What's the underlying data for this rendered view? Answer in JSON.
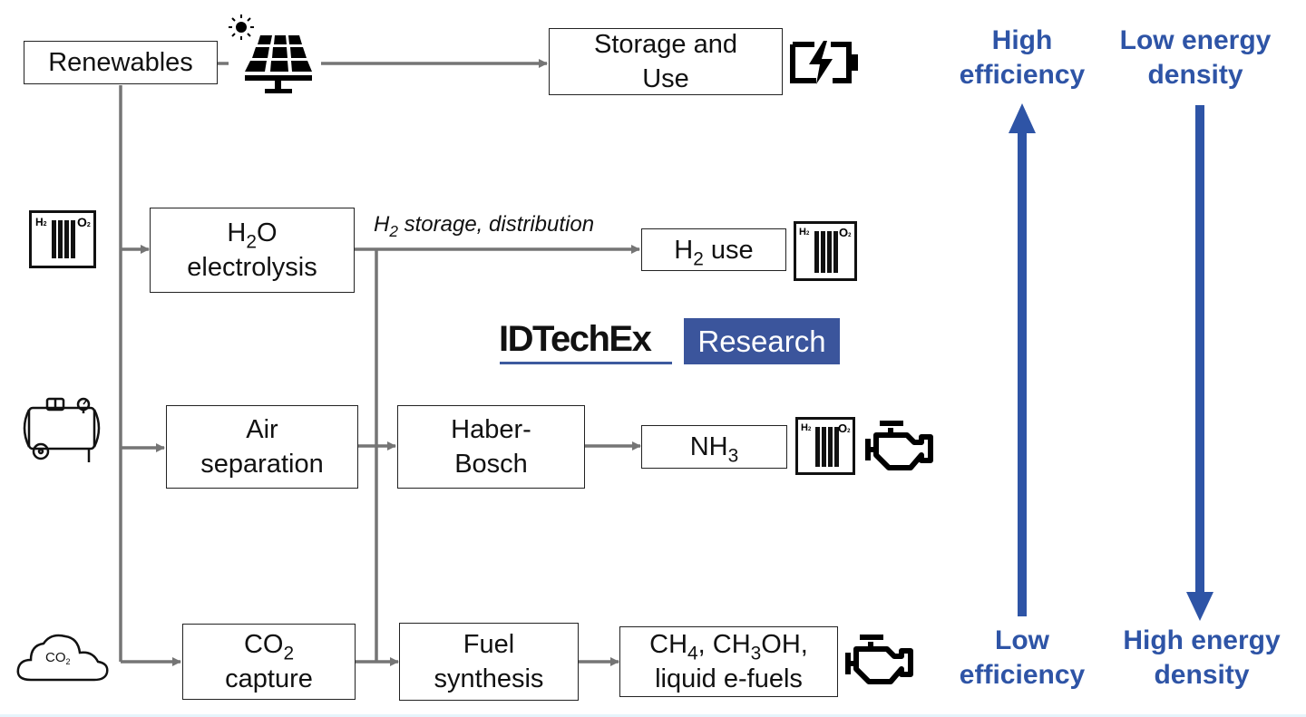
{
  "diagram": {
    "source_label": "Renewables",
    "nodes": {
      "storage": {
        "line1": "Storage and",
        "line2": "Use"
      },
      "electrolysis": {
        "formula_main": "H",
        "formula_sub": "2",
        "formula_tail": "O",
        "line2": "electrolysis"
      },
      "h2_use": {
        "main": "H",
        "sub": "2",
        "tail": " use"
      },
      "air_separation": {
        "line1": "Air",
        "line2": "separation"
      },
      "haber_bosch": {
        "line1": "Haber-",
        "line2": "Bosch"
      },
      "nh3": {
        "main": "NH",
        "sub": "3"
      },
      "co2_capture": {
        "main": "CO",
        "sub": "2",
        "line2": "capture"
      },
      "fuel_synthesis": {
        "line1": "Fuel",
        "line2": "synthesis"
      },
      "efuels": {
        "a": "CH",
        "a_sub": "4",
        "b": ", CH",
        "b_sub": "3",
        "c": "OH,",
        "line2": "liquid e-fuels"
      }
    },
    "edge_labels": {
      "h2_distribution": {
        "main": "H",
        "sub": "2",
        "tail": " storage, distribution"
      }
    },
    "icons": {
      "fuel_cell_h2": "H",
      "fuel_cell_h2_sub": "2",
      "fuel_cell_o2": "O",
      "fuel_cell_o2_sub": "2",
      "co2_cloud_main": "CO",
      "co2_cloud_sub": "2"
    },
    "scales": {
      "efficiency": {
        "top": [
          "High",
          "efficiency"
        ],
        "bottom": [
          "Low",
          "efficiency"
        ],
        "direction": "up"
      },
      "energy_density": {
        "top": [
          "Low energy",
          "density"
        ],
        "bottom": [
          "High energy",
          "density"
        ],
        "direction": "down"
      }
    },
    "logo": {
      "brand": "IDTechEx",
      "badge": "Research"
    },
    "colors": {
      "accent_blue": "#2e54a6",
      "connector_gray": "#757575",
      "text": "#111111"
    }
  }
}
